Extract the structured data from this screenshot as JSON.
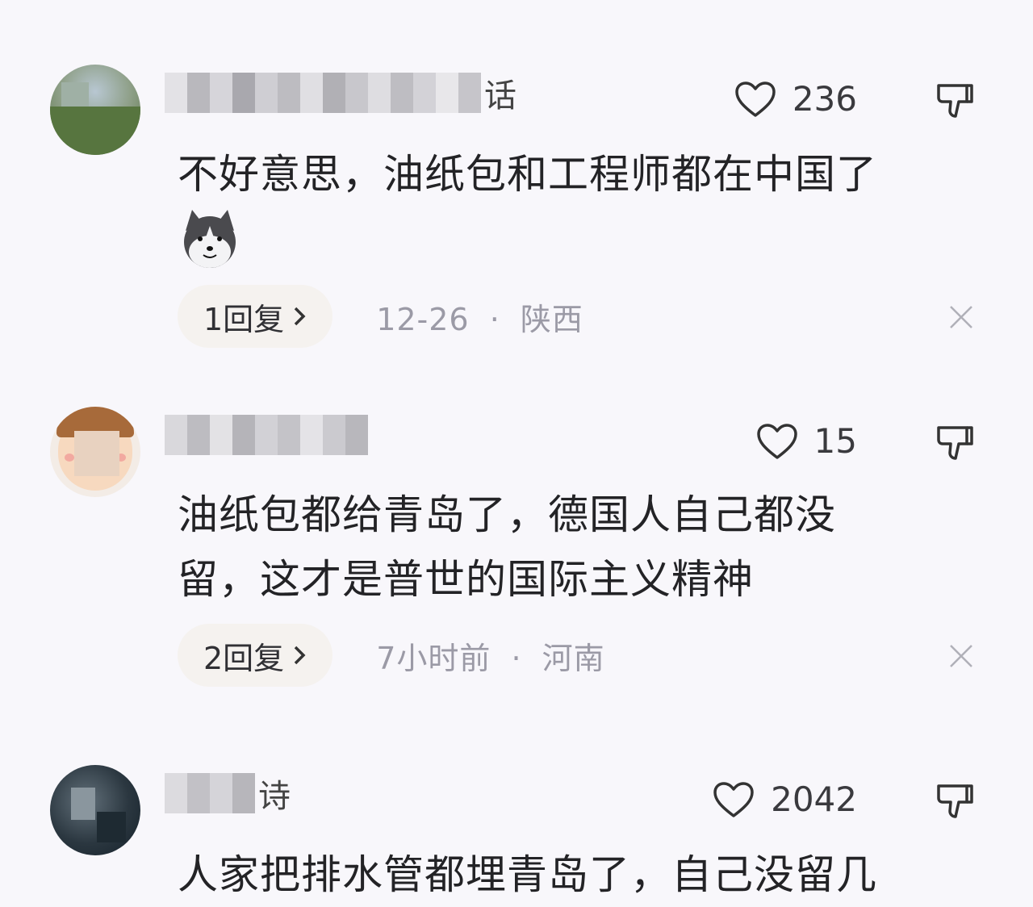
{
  "comments": [
    {
      "username_tail": "话",
      "likes": "236",
      "text": "不好意思，油纸包和工程师都在中国了",
      "has_emoji": true,
      "emoji_icon": "husky-dog-emoji-icon",
      "reply_label": "1回复",
      "date": "12-26",
      "location": "陕西"
    },
    {
      "username_tail": "",
      "likes": "15",
      "text_lines": [
        "油纸包都给青岛了，德国人自己都没",
        "留，这才是普世的国际主义精神"
      ],
      "reply_label": "2回复",
      "date": "7小时前",
      "location": "河南"
    },
    {
      "username_tail": "诗",
      "likes": "2042",
      "text": "人家把排水管都埋青岛了，自己没留几"
    }
  ],
  "separator": "·",
  "icons": {
    "like": "heart-outline-icon",
    "dislike": "thumbs-down-icon",
    "reply_arrow": "chevron-right-icon",
    "close": "close-icon"
  }
}
